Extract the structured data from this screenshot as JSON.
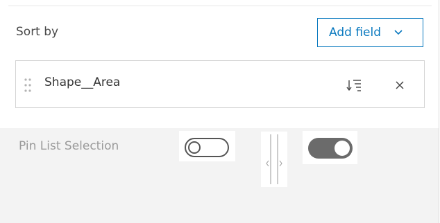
{
  "sort": {
    "label": "Sort by",
    "add_field_label": "Add field",
    "items": [
      {
        "field": "Shape__Area",
        "order_icon": "sort-descending-icon",
        "remove_icon": "close-icon"
      }
    ]
  },
  "pin_list": {
    "label": "Pin List Selection",
    "toggle_left_state": "off",
    "toggle_right_state": "on"
  },
  "colors": {
    "accent": "#0a79bf",
    "toggle_on": "#6b6b6b",
    "muted_text": "#9a9a9a",
    "panel_bg": "#f3f3f3"
  }
}
